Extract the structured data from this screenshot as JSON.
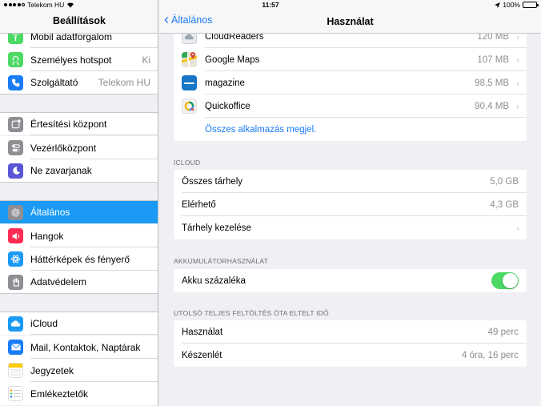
{
  "status_bar": {
    "carrier": "Telekom HU",
    "time": "11:57",
    "battery": "100%"
  },
  "sidebar": {
    "title": "Beállítások",
    "items": [
      {
        "label": "Mobil adatforgalom",
        "value": "",
        "icon": "antenna-icon",
        "color": "#4cd964"
      },
      {
        "label": "Személyes hotspot",
        "value": "Ki",
        "icon": "hotspot-icon",
        "color": "#4cd964"
      },
      {
        "label": "Szolgáltató",
        "value": "Telekom HU",
        "icon": "phone-icon",
        "color": "#1a7cf7"
      },
      {
        "label": "Értesítési központ",
        "value": "",
        "icon": "notification-icon",
        "color": "#8e8e93"
      },
      {
        "label": "Vezérlőközpont",
        "value": "",
        "icon": "toggles-icon",
        "color": "#8e8e93"
      },
      {
        "label": "Ne zavarjanak",
        "value": "",
        "icon": "moon-icon",
        "color": "#5856d6"
      },
      {
        "label": "Általános",
        "value": "",
        "icon": "gear-icon",
        "color": "#8e8e93"
      },
      {
        "label": "Hangok",
        "value": "",
        "icon": "speaker-icon",
        "color": "#ff2d55"
      },
      {
        "label": "Háttérképek és fényerő",
        "value": "",
        "icon": "flower-icon",
        "color": "#1a9af5"
      },
      {
        "label": "Adatvédelem",
        "value": "",
        "icon": "hand-icon",
        "color": "#8e8e93"
      },
      {
        "label": "iCloud",
        "value": "",
        "icon": "cloud-icon",
        "color": "#1a9af5"
      },
      {
        "label": "Mail, Kontaktok, Naptárak",
        "value": "",
        "icon": "mail-icon",
        "color": "#1a7cf7"
      },
      {
        "label": "Jegyzetek",
        "value": "",
        "icon": "notes-icon",
        "color": "#ffcc00"
      },
      {
        "label": "Emlékeztetők",
        "value": "",
        "icon": "list-icon",
        "color": "#ffffff"
      }
    ]
  },
  "main": {
    "back_label": "Általános",
    "title": "Használat",
    "apps": [
      {
        "name": "CloudReaders",
        "size": "120 MB",
        "icon": "cloudreaders-icon"
      },
      {
        "name": "Google Maps",
        "size": "107 MB",
        "icon": "google-maps-icon"
      },
      {
        "name": "magazine",
        "size": "98,5 MB",
        "icon": "magazine-icon"
      },
      {
        "name": "Quickoffice",
        "size": "90,4 MB",
        "icon": "quickoffice-icon"
      }
    ],
    "show_all": "Összes alkalmazás megjel.",
    "icloud": {
      "title": "ICLOUD",
      "rows": [
        {
          "label": "Összes tárhely",
          "value": "5,0 GB"
        },
        {
          "label": "Elérhető",
          "value": "4,3 GB"
        },
        {
          "label": "Tárhely kezelése",
          "value": ""
        }
      ]
    },
    "battery": {
      "title": "AKKUMULÁTORHASZNÁLAT",
      "label": "Akku százaléka",
      "on": true
    },
    "since_charge": {
      "title": "UTOLSÓ TELJES FELTÖLTÉS ÓTA ELTELT IDŐ",
      "rows": [
        {
          "label": "Használat",
          "value": "49 perc"
        },
        {
          "label": "Készenlét",
          "value": "4 óra, 16 perc"
        }
      ]
    }
  }
}
